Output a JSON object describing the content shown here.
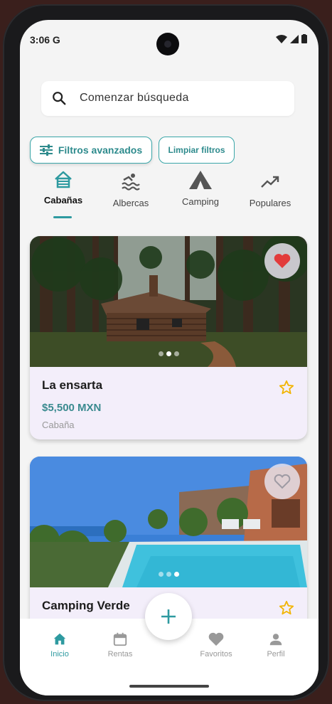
{
  "status": {
    "time": "3:06",
    "carrier_icon": "google-g-icon"
  },
  "search": {
    "placeholder": "Comenzar búsqueda"
  },
  "filters": {
    "advanced_label": "Filtros avanzados",
    "clear_label": "Limpiar filtros"
  },
  "categories": [
    {
      "label": "Cabañas",
      "icon": "cabin-icon",
      "active": true
    },
    {
      "label": "Albercas",
      "icon": "pool-icon",
      "active": false
    },
    {
      "label": "Camping",
      "icon": "tent-icon",
      "active": false
    },
    {
      "label": "Populares",
      "icon": "trending-icon",
      "active": false
    }
  ],
  "listings": [
    {
      "name": "La ensarta",
      "price": "$5,500 MXN",
      "type": "Cabaña",
      "favorite": true
    },
    {
      "name": "Camping Verde",
      "favorite": false
    }
  ],
  "nav": {
    "items": [
      {
        "label": "Inicio",
        "icon": "home-icon",
        "active": true
      },
      {
        "label": "Rentas",
        "icon": "calendar-icon",
        "active": false
      },
      {
        "label": "Favoritos",
        "icon": "heart-icon",
        "active": false
      },
      {
        "label": "Perfil",
        "icon": "person-icon",
        "active": false
      }
    ],
    "fab_icon": "plus-icon"
  },
  "colors": {
    "accent": "#2e9aa0",
    "favorite": "#e23b3b",
    "star": "#f2b400"
  }
}
